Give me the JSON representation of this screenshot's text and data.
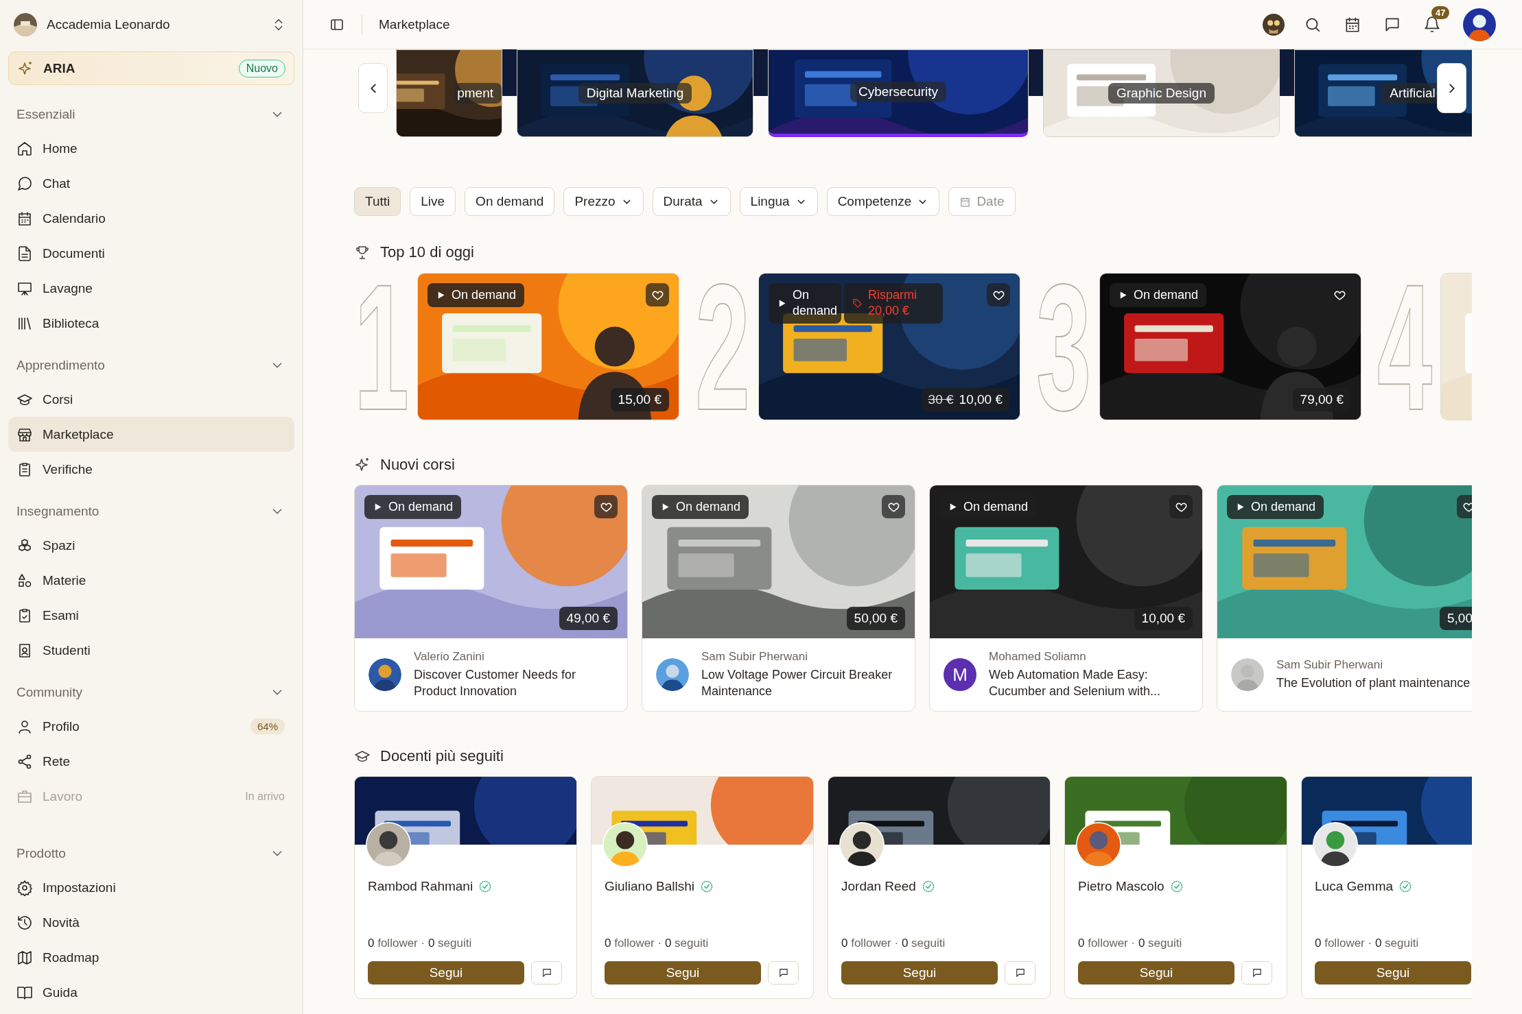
{
  "workspace": {
    "name": "Accademia Leonardo"
  },
  "aria": {
    "label": "ARIA",
    "badge": "Nuovo"
  },
  "sidebar": {
    "sections": [
      {
        "title": "Essenziali",
        "expanded": true,
        "items": [
          {
            "label": "Home",
            "selected": false
          },
          {
            "label": "Chat",
            "selected": false
          },
          {
            "label": "Calendario",
            "selected": false
          },
          {
            "label": "Documenti",
            "selected": false
          },
          {
            "label": "Lavagne",
            "selected": false
          },
          {
            "label": "Biblioteca",
            "selected": false
          }
        ]
      },
      {
        "title": "Apprendimento",
        "expanded": true,
        "items": [
          {
            "label": "Corsi",
            "selected": false
          },
          {
            "label": "Marketplace",
            "selected": true
          },
          {
            "label": "Verifiche",
            "selected": false
          }
        ]
      },
      {
        "title": "Insegnamento",
        "expanded": true,
        "items": [
          {
            "label": "Spazi",
            "selected": false
          },
          {
            "label": "Materie",
            "selected": false
          },
          {
            "label": "Esami",
            "selected": false
          },
          {
            "label": "Studenti",
            "selected": false
          }
        ]
      },
      {
        "title": "Community",
        "expanded": true,
        "items": [
          {
            "label": "Profilo",
            "selected": false,
            "disabled": false,
            "badge": "64%"
          },
          {
            "label": "Rete",
            "selected": false,
            "disabled": false
          },
          {
            "label": "Lavoro",
            "selected": false,
            "disabled": true,
            "note": "In arrivo"
          }
        ]
      },
      {
        "title": "Prodotto",
        "expanded": true,
        "items": [
          {
            "label": "Impostazioni",
            "selected": false
          },
          {
            "label": "Novità",
            "selected": false
          },
          {
            "label": "Roadmap",
            "selected": false
          },
          {
            "label": "Guida",
            "selected": false
          }
        ]
      }
    ]
  },
  "topbar": {
    "title": "Marketplace",
    "notifications": "47"
  },
  "categories": [
    {
      "label": "pment",
      "selected": false
    },
    {
      "label": "Digital Marketing",
      "selected": false
    },
    {
      "label": "Cybersecurity",
      "selected": true
    },
    {
      "label": "Graphic Design",
      "selected": false
    },
    {
      "label": "Artificial",
      "selected": false
    }
  ],
  "filters": [
    {
      "label": "Tutti",
      "kind": "chip",
      "selected": true
    },
    {
      "label": "Live",
      "kind": "chip",
      "selected": false
    },
    {
      "label": "On demand",
      "kind": "chip",
      "selected": false
    },
    {
      "label": "Prezzo",
      "kind": "dropdown",
      "selected": false
    },
    {
      "label": "Durata",
      "kind": "dropdown",
      "selected": false
    },
    {
      "label": "Lingua",
      "kind": "dropdown",
      "selected": false
    },
    {
      "label": "Competenze",
      "kind": "dropdown",
      "selected": false
    },
    {
      "label": "Date",
      "kind": "date",
      "selected": false
    }
  ],
  "top10": {
    "title": "Top 10 di oggi",
    "items": [
      {
        "rank": "1",
        "badge": "On demand",
        "price": "15,00 €"
      },
      {
        "rank": "2",
        "badge": "On demand",
        "discount": "Risparmi 20,00 €",
        "old_price": "30 €",
        "price": "10,00 €"
      },
      {
        "rank": "3",
        "badge": "On demand",
        "price": "79,00 €"
      },
      {
        "rank": "4"
      }
    ]
  },
  "new_courses": {
    "title": "Nuovi corsi",
    "items": [
      {
        "badge": "On demand",
        "price": "49,00 €",
        "author": "Valerio Zanini",
        "title": "Discover Customer Needs for Product Innovation"
      },
      {
        "badge": "On demand",
        "price": "50,00 €",
        "author": "Sam Subir Pherwani",
        "title": "Low Voltage Power Circuit Breaker Maintenance"
      },
      {
        "badge": "On demand",
        "price": "10,00 €",
        "author": "Mohamed Soliamn",
        "title": "Web Automation Made Easy: Cucumber and Selenium with...",
        "avatar_initial": "M"
      },
      {
        "badge": "On demand",
        "price": "5,00",
        "author": "Sam Subir Pherwani",
        "title": "The Evolution of plant maintenance"
      }
    ]
  },
  "teachers": {
    "title": "Docenti più seguiti",
    "items": [
      {
        "name": "Rambod Rahmani",
        "verified": true,
        "stats": "**0** follower · **0** seguiti",
        "follow": "Segui",
        "message": true
      },
      {
        "name": "Giuliano Ballshi",
        "verified": true,
        "stats": "**0** follower · **0** seguiti",
        "follow": "Segui",
        "message": true
      },
      {
        "name": "Jordan Reed",
        "verified": true,
        "stats": "**0** follower · **0** seguiti",
        "follow": "Segui",
        "message": true
      },
      {
        "name": "Pietro Mascolo",
        "verified": true,
        "stats": "**0** follower · **0** seguiti",
        "follow": "Segui",
        "message": true
      },
      {
        "name": "Luca Gemma",
        "verified": true,
        "stats": "**0** follower · **0** seguiti",
        "follow": "Segui",
        "message": false
      }
    ]
  }
}
